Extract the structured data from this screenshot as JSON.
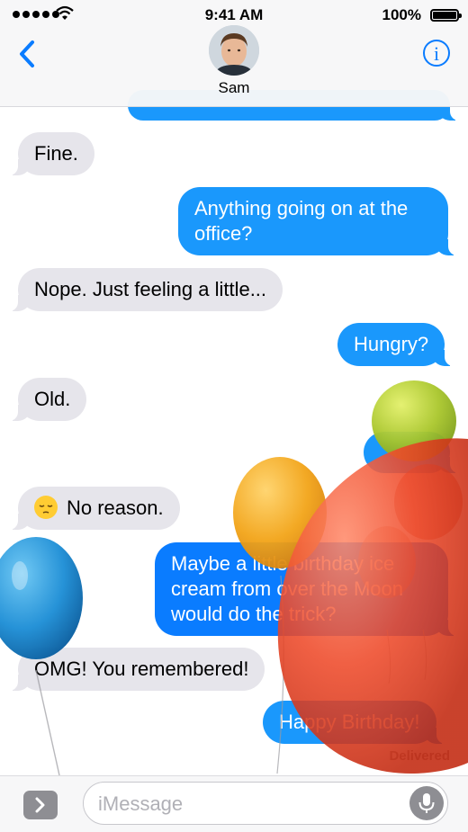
{
  "status_bar": {
    "time": "9:41 AM",
    "battery_percent": "100%"
  },
  "header": {
    "contact_name": "Sam",
    "back_icon": "chevron-left-icon",
    "info_icon": "info-icon",
    "info_glyph": "i",
    "accent_color": "#0a7cff"
  },
  "messages": [
    {
      "id": "m1",
      "from": "me",
      "text": ""
    },
    {
      "id": "m2",
      "from": "them",
      "text": "Fine."
    },
    {
      "id": "m3",
      "from": "me",
      "line1": "Anything going on at the",
      "line2": "office?"
    },
    {
      "id": "m4",
      "from": "them",
      "text": "Nope. Just feeling a little..."
    },
    {
      "id": "m5",
      "from": "me",
      "text": "Hungry?"
    },
    {
      "id": "m6",
      "from": "them",
      "text": "Old."
    },
    {
      "id": "m7",
      "from": "them",
      "emoji": "pensive-face-icon",
      "text": "No reason."
    },
    {
      "id": "m8",
      "from": "me",
      "line1": "Maybe a little birthday ice",
      "line2": "cream from over the Moon",
      "line3": "would do the trick?"
    },
    {
      "id": "m9",
      "from": "them",
      "text": "OMG! You remembered!"
    },
    {
      "id": "m10",
      "from": "me",
      "text": "Happy Birthday!"
    }
  ],
  "delivered_label": "Delivered",
  "composer": {
    "placeholder": "iMessage",
    "apps_icon": "chevron-right-icon",
    "mic_icon": "microphone-icon"
  },
  "effect": {
    "name": "balloons",
    "colors": [
      "#e83a1f",
      "#f2a418",
      "#a9c62b",
      "#1f8fd6",
      "#0a66c4"
    ]
  },
  "colors": {
    "outgoing_bubble": "#1a98fc",
    "incoming_bubble": "#e6e5eb"
  }
}
